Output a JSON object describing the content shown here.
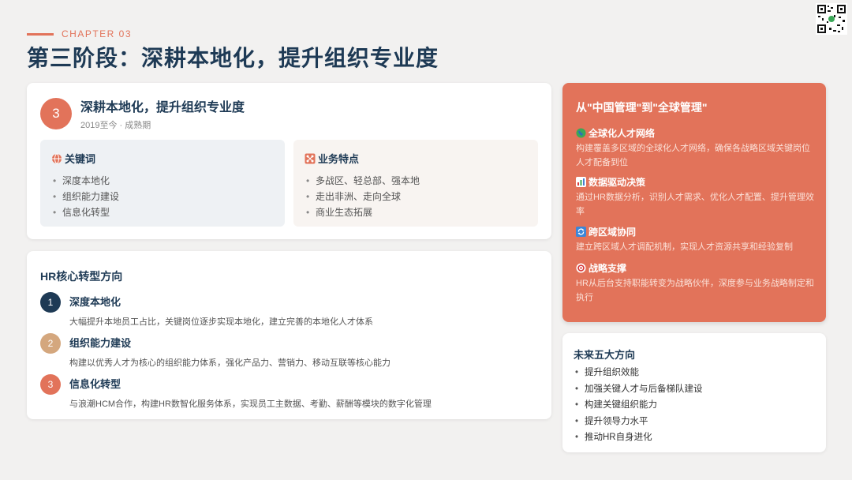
{
  "header": {
    "chapter": "CHAPTER 03",
    "title": "第三阶段：深耕本地化，提升组织专业度"
  },
  "stage": {
    "number": "3",
    "title": "深耕本地化，提升组织专业度",
    "subtitle": "2019至今 · 成熟期",
    "keywords": {
      "heading": "关键词",
      "icon": "globe-icon",
      "items": [
        "深度本地化",
        "组织能力建设",
        "信息化转型"
      ]
    },
    "features": {
      "heading": "业务特点",
      "icon": "network-icon",
      "items": [
        "多战区、轻总部、强本地",
        "走出非洲、走向全球",
        "商业生态拓展"
      ]
    }
  },
  "hr": {
    "title": "HR核心转型方向",
    "items": [
      {
        "num": "1",
        "name": "深度本地化",
        "desc": "大幅提升本地员工占比，关键岗位逐步实现本地化，建立完善的本地化人才体系",
        "color": "#1e3a55"
      },
      {
        "num": "2",
        "name": "组织能力建设",
        "desc": "构建以优秀人才为核心的组织能力体系，强化产品力、营销力、移动互联等核心能力",
        "color": "#d4a77e"
      },
      {
        "num": "3",
        "name": "信息化转型",
        "desc": "与浪潮HCM合作，构建HR数智化服务体系，实现员工主数据、考勤、薪酬等模块的数字化管理",
        "color": "#e2735a"
      }
    ]
  },
  "global": {
    "title": "从\"中国管理\"到\"全球管理\"",
    "items": [
      {
        "name": "全球化人才网络",
        "icon": "globe-icon",
        "icon_color": "#3aa757",
        "desc": "构建覆盖多区域的全球化人才网络，确保各战略区域关键岗位人才配备到位"
      },
      {
        "name": "数据驱动决策",
        "icon": "bar-chart-icon",
        "icon_color": "#4a7fd0",
        "desc": "通过HR数据分析，识别人才需求、优化人才配置、提升管理效率"
      },
      {
        "name": "跨区域协同",
        "icon": "sync-icon",
        "icon_color": "#3b86d8",
        "desc": "建立跨区域人才调配机制，实现人才资源共享和经验复制"
      },
      {
        "name": "战略支撑",
        "icon": "target-icon",
        "icon_color": "#d83b3b",
        "desc": "HR从后台支持职能转变为战略伙伴，深度参与业务战略制定和执行"
      }
    ]
  },
  "future": {
    "title": "未来五大方向",
    "items": [
      "提升组织效能",
      "加强关键人才与后备梯队建设",
      "构建关键组织能力",
      "提升领导力水平",
      "推动HR自身进化"
    ]
  },
  "colors": {
    "accent": "#e2735a",
    "navy": "#1e3a55",
    "gold": "#d4a77e"
  }
}
